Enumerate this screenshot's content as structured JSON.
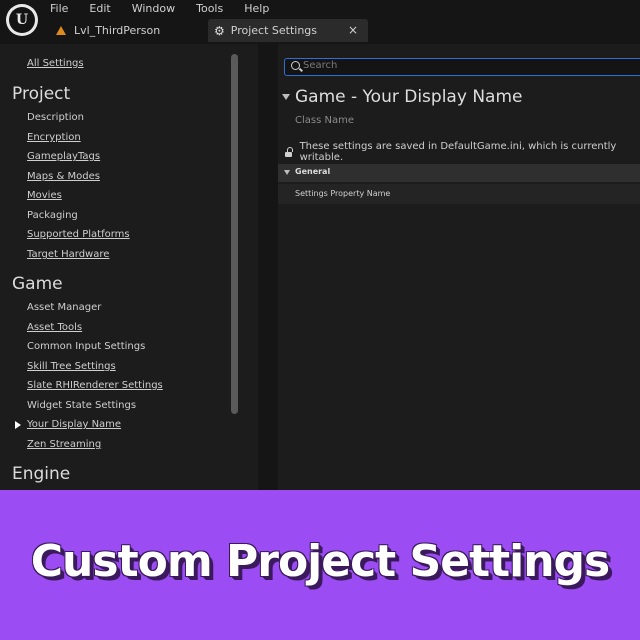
{
  "menu": {
    "items": [
      "File",
      "Edit",
      "Window",
      "Tools",
      "Help"
    ]
  },
  "tabs": {
    "level": "Lvl_ThirdPerson",
    "settings": "Project Settings",
    "close": "×"
  },
  "sidebar": {
    "all_settings": "All Settings",
    "sections": [
      {
        "title": "Project",
        "items": [
          "Description",
          "Encryption",
          "GameplayTags",
          "Maps & Modes",
          "Movies",
          "Packaging",
          "Supported Platforms",
          "Target Hardware"
        ]
      },
      {
        "title": "Game",
        "items": [
          "Asset Manager",
          "Asset Tools",
          "Common Input Settings",
          "Skill Tree Settings",
          "Slate RHIRenderer Settings",
          "Widget State Settings",
          "Your Display Name",
          "Zen Streaming"
        ]
      },
      {
        "title": "Engine",
        "items": []
      }
    ],
    "selected": "Your Display Name"
  },
  "main": {
    "search_placeholder": "Search",
    "header": "Game - Your Display Name",
    "class_name": "Class Name",
    "notice": "These settings are saved in DefaultGame.ini, which is currently writable.",
    "category": "General",
    "property": "Settings Property Name"
  },
  "banner": {
    "text": "Custom Project Settings"
  },
  "colors": {
    "accent": "#2f6fd4",
    "banner": "#9b4cf2",
    "level_icon": "#e08a1e"
  }
}
